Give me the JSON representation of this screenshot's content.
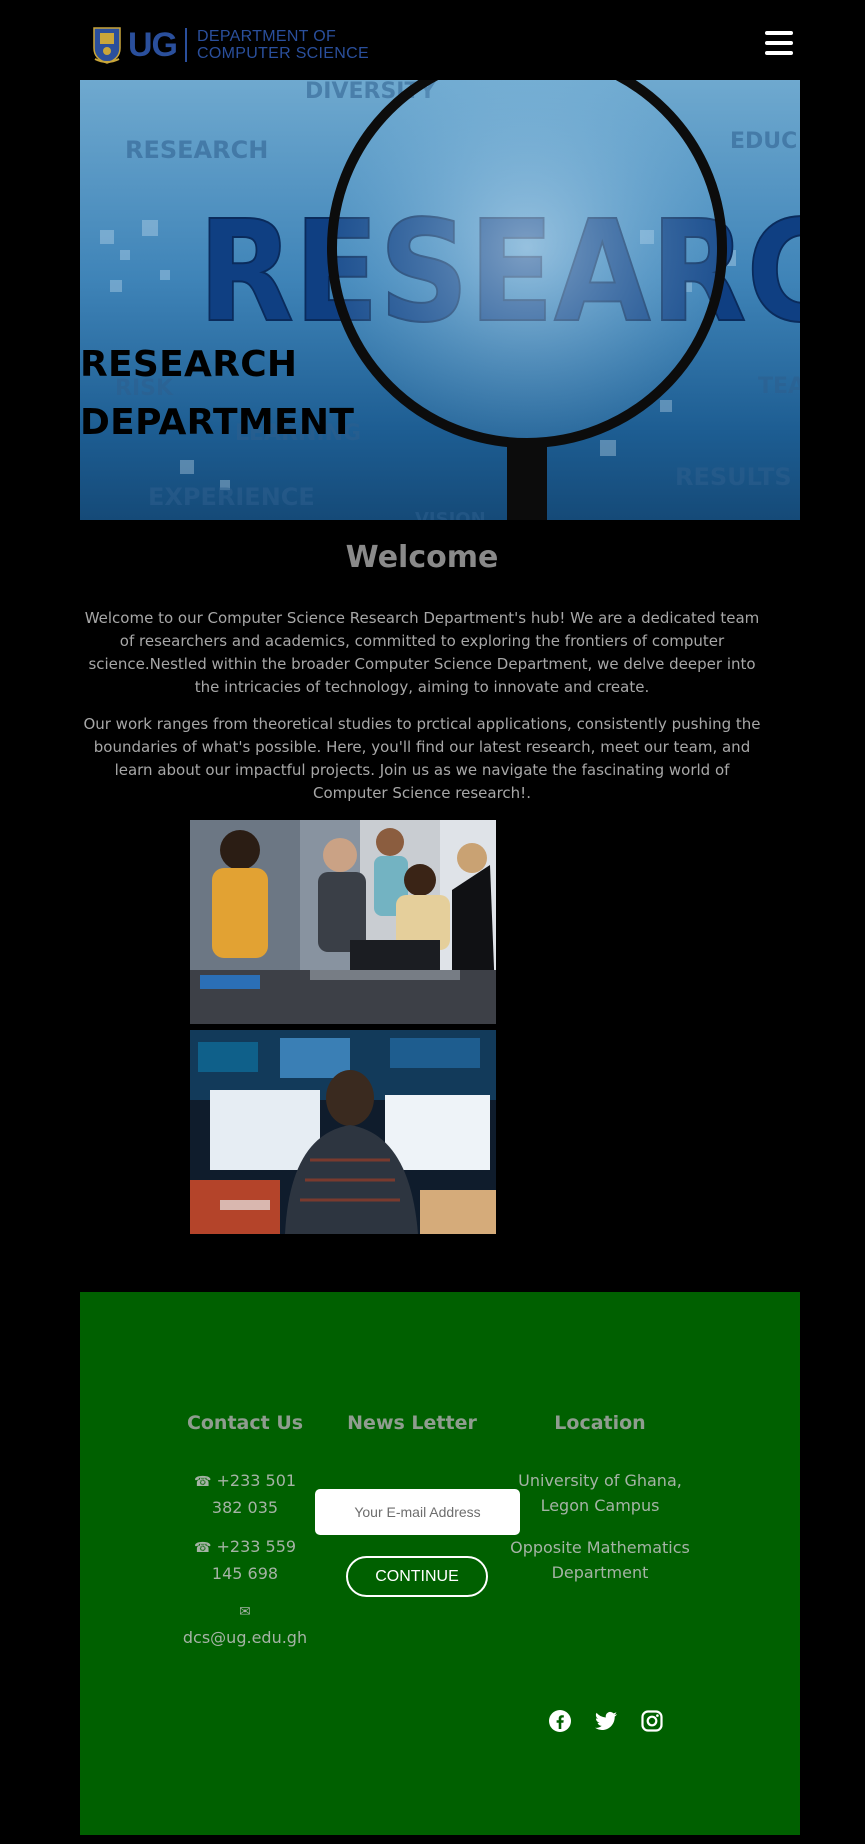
{
  "header": {
    "logo_mark": "UG",
    "department_line1": "DEPARTMENT OF",
    "department_line2": "COMPUTER SCIENCE",
    "menu_icon": "hamburger-menu-icon"
  },
  "hero": {
    "title": "RESEARCH\nDEPARTMENT",
    "banner_words": {
      "main": "RESEARC",
      "diversity": "DIVERSITY",
      "research": "RESEARCH",
      "risk": "RISK",
      "learning": "LEARNING",
      "experience": "EXPERIENCE",
      "results": "RESULTS",
      "educ": "EDUC",
      "tea": "TEA",
      "vision": "VISION"
    }
  },
  "welcome": {
    "heading": "Welcome",
    "paragraph1": "Welcome to our Computer Science Research Department's hub! We are a dedicated team of researchers and academics, committed to exploring the frontiers of computer science.Nestled within the broader Computer Science Department, we delve deeper into the intricacies of technology, aiming to innovate and create.",
    "paragraph2": "Our work ranges from theoretical studies to prctical applications, consistently pushing the boundaries of what's possible. Here, you'll find our latest research, meet our team, and learn about our impactful projects. Join us as we navigate the fascinating world of Computer Science research!."
  },
  "footer": {
    "contact": {
      "title": "Contact Us",
      "phone_icon": "☎",
      "phone1": "+233 501 382 035",
      "phone2": "+233 559 145 698",
      "mail_icon": "✉",
      "email": "dcs@ug.edu.gh"
    },
    "newsletter": {
      "title": "News Letter",
      "email_placeholder": "Your E-mail Address",
      "email_value": "",
      "button_label": "CONTINUE"
    },
    "location": {
      "title": "Location",
      "line1": "University of Ghana, Legon Campus",
      "line2": "Opposite Mathematics Department"
    },
    "social": [
      "facebook-icon",
      "twitter-icon",
      "instagram-icon"
    ]
  },
  "colors": {
    "page_background": "#000000",
    "brand_blue": "#2a4f9c",
    "footer_green": "#006000",
    "muted_text": "#a7a7a7"
  }
}
